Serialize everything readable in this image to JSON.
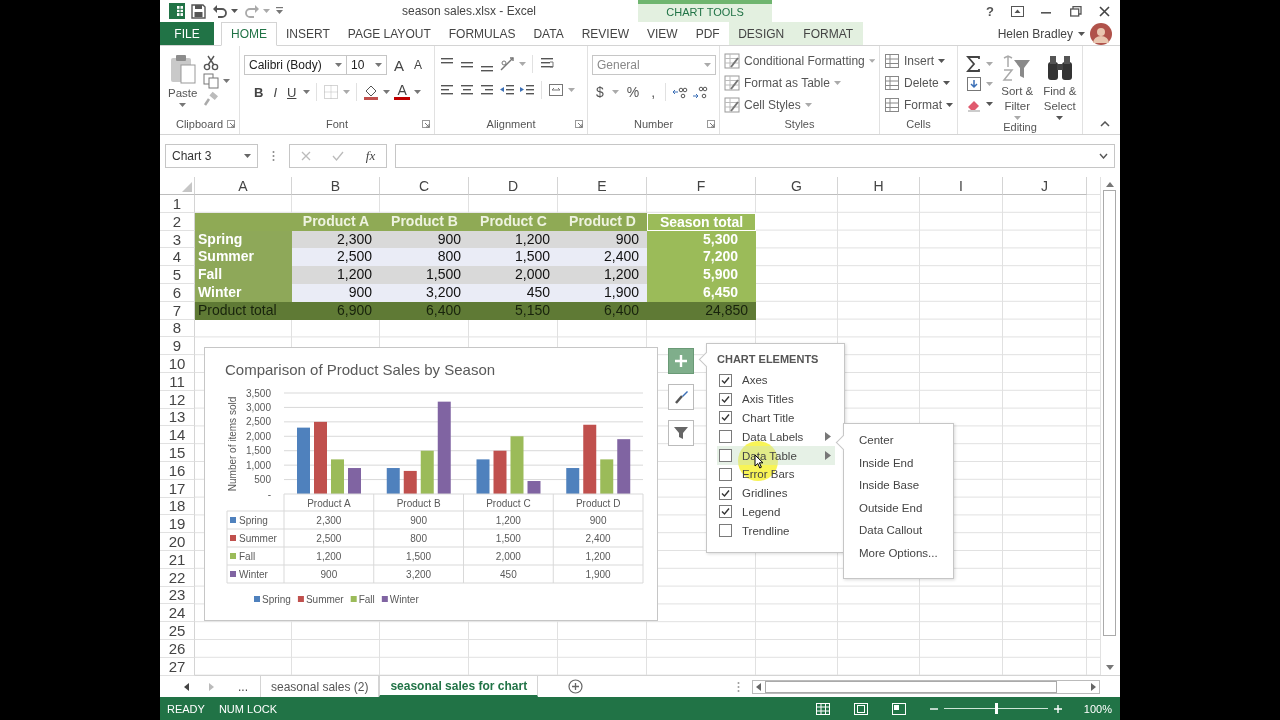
{
  "window": {
    "title": "season sales.xlsx - Excel",
    "contextual_group": "CHART TOOLS",
    "help": "?"
  },
  "account": {
    "user": "Helen Bradley"
  },
  "ribbon_tabs": [
    {
      "label": "FILE",
      "kind": "file",
      "selected": false
    },
    {
      "label": "HOME",
      "kind": "normal",
      "selected": true
    },
    {
      "label": "INSERT",
      "kind": "normal",
      "selected": false
    },
    {
      "label": "PAGE LAYOUT",
      "kind": "normal",
      "selected": false
    },
    {
      "label": "FORMULAS",
      "kind": "normal",
      "selected": false
    },
    {
      "label": "DATA",
      "kind": "normal",
      "selected": false
    },
    {
      "label": "REVIEW",
      "kind": "normal",
      "selected": false
    },
    {
      "label": "VIEW",
      "kind": "normal",
      "selected": false
    },
    {
      "label": "PDF",
      "kind": "normal",
      "selected": false
    },
    {
      "label": "DESIGN",
      "kind": "contextual",
      "selected": false
    },
    {
      "label": "FORMAT",
      "kind": "contextual",
      "selected": false
    }
  ],
  "ribbon": {
    "clipboard": {
      "paste": "Paste",
      "label": "Clipboard"
    },
    "font": {
      "font_name": "Calibri (Body)",
      "font_size": "10",
      "grow": "A",
      "shrink": "A",
      "styles": [
        "B",
        "I",
        "U"
      ],
      "font_color": "A",
      "label": "Font"
    },
    "alignment": {
      "label": "Alignment"
    },
    "number": {
      "format": "General",
      "symbols": [
        "$",
        "%",
        ","
      ],
      "label": "Number"
    },
    "styles": {
      "items": [
        "Conditional Formatting",
        "Format as Table",
        "Cell Styles"
      ],
      "label": "Styles"
    },
    "cells": {
      "items": [
        "Insert",
        "Delete",
        "Format"
      ],
      "label": "Cells"
    },
    "editing": {
      "sort": "Sort & Filter",
      "find": "Find & Select",
      "label": "Editing"
    }
  },
  "formula_bar": {
    "name_box": "Chart 3",
    "function_label": "fx"
  },
  "sheet": {
    "columns": [
      "A",
      "B",
      "C",
      "D",
      "E",
      "F",
      "G",
      "H",
      "I",
      "J"
    ],
    "rows": [
      {
        "number": "1",
        "kind": "blank"
      },
      {
        "number": "2",
        "kind": "header",
        "cells": [
          null,
          "Product A",
          "Product B",
          "Product C",
          "Product D",
          "Season total"
        ]
      },
      {
        "number": "3",
        "kind": "data",
        "cells": [
          "Spring",
          "2,300",
          "900",
          "1,200",
          "900",
          "5,300"
        ]
      },
      {
        "number": "4",
        "kind": "data",
        "cells": [
          "Summer",
          "2,500",
          "800",
          "1,500",
          "2,400",
          "7,200"
        ]
      },
      {
        "number": "5",
        "kind": "data",
        "cells": [
          "Fall",
          "1,200",
          "1,500",
          "2,000",
          "1,200",
          "5,900"
        ]
      },
      {
        "number": "6",
        "kind": "data",
        "cells": [
          "Winter",
          "900",
          "3,200",
          "450",
          "1,900",
          "6,450"
        ]
      },
      {
        "number": "7",
        "kind": "total",
        "cells": [
          "Product total",
          "6,900",
          "6,400",
          "5,150",
          "6,400",
          "24,850"
        ]
      },
      {
        "number": "8",
        "kind": "blank"
      },
      {
        "number": "9",
        "kind": "blank"
      },
      {
        "number": "10",
        "kind": "blank"
      },
      {
        "number": "11",
        "kind": "blank"
      },
      {
        "number": "12",
        "kind": "blank"
      },
      {
        "number": "13",
        "kind": "blank"
      },
      {
        "number": "14",
        "kind": "blank"
      },
      {
        "number": "15",
        "kind": "blank"
      },
      {
        "number": "16",
        "kind": "blank"
      },
      {
        "number": "17",
        "kind": "blank"
      },
      {
        "number": "18",
        "kind": "blank"
      },
      {
        "number": "19",
        "kind": "blank"
      },
      {
        "number": "20",
        "kind": "blank"
      },
      {
        "number": "21",
        "kind": "blank"
      },
      {
        "number": "22",
        "kind": "blank"
      },
      {
        "number": "23",
        "kind": "blank"
      },
      {
        "number": "24",
        "kind": "blank"
      },
      {
        "number": "25",
        "kind": "blank"
      },
      {
        "number": "26",
        "kind": "blank"
      },
      {
        "number": "27",
        "kind": "blank"
      }
    ]
  },
  "chart": {
    "chart_data": {
      "type": "bar",
      "title": "Comparison of Product Sales by Season",
      "ylabel": "Number of items sold",
      "categories": [
        "Product A",
        "Product B",
        "Product C",
        "Product D"
      ],
      "series": [
        {
          "name": "Spring",
          "color": "#4f81bd",
          "values": [
            2300,
            900,
            1200,
            900
          ]
        },
        {
          "name": "Summer",
          "color": "#c0504d",
          "values": [
            2500,
            800,
            1500,
            2400
          ]
        },
        {
          "name": "Fall",
          "color": "#9bbb59",
          "values": [
            1200,
            1500,
            2000,
            1200
          ]
        },
        {
          "name": "Winter",
          "color": "#8064a2",
          "values": [
            900,
            3200,
            450,
            1900
          ]
        }
      ],
      "ylim": [
        0,
        3500
      ],
      "grid": true,
      "legend": true,
      "yticks": [
        {
          "value": 0,
          "label": "-"
        },
        {
          "value": 500,
          "label": "500"
        },
        {
          "value": 1000,
          "label": "1,000"
        },
        {
          "value": 1500,
          "label": "1,500"
        },
        {
          "value": 2000,
          "label": "2,000"
        },
        {
          "value": 2500,
          "label": "2,500"
        },
        {
          "value": 3000,
          "label": "3,000"
        },
        {
          "value": 3500,
          "label": "3,500"
        }
      ]
    },
    "data_table": [
      {
        "label": "Spring",
        "cells": [
          "2,300",
          "900",
          "1,200",
          "900"
        ]
      },
      {
        "label": "Summer",
        "cells": [
          "2,500",
          "800",
          "1,500",
          "2,400"
        ]
      },
      {
        "label": "Fall",
        "cells": [
          "1,200",
          "1,500",
          "2,000",
          "1,200"
        ]
      },
      {
        "label": "Winter",
        "cells": [
          "900",
          "3,200",
          "450",
          "1,900"
        ]
      }
    ],
    "buttons": [
      {
        "kind": "elements",
        "selected": true
      },
      {
        "kind": "styles",
        "selected": false
      },
      {
        "kind": "filters",
        "selected": false
      }
    ]
  },
  "chart_elements": {
    "title": "CHART ELEMENTS",
    "items": [
      {
        "label": "Axes",
        "checked": true,
        "submenu": false,
        "hovered": false
      },
      {
        "label": "Axis Titles",
        "checked": true,
        "submenu": false,
        "hovered": false
      },
      {
        "label": "Chart Title",
        "checked": true,
        "submenu": false,
        "hovered": false
      },
      {
        "label": "Data Labels",
        "checked": false,
        "submenu": true,
        "hovered": false
      },
      {
        "label": "Data Table",
        "checked": false,
        "submenu": true,
        "hovered": true
      },
      {
        "label": "Error Bars",
        "checked": false,
        "submenu": false,
        "hovered": false
      },
      {
        "label": "Gridlines",
        "checked": true,
        "submenu": false,
        "hovered": false
      },
      {
        "label": "Legend",
        "checked": true,
        "submenu": false,
        "hovered": false
      },
      {
        "label": "Trendline",
        "checked": false,
        "submenu": false,
        "hovered": false
      }
    ],
    "submenu": [
      "Center",
      "Inside End",
      "Inside Base",
      "Outside End",
      "Data Callout",
      "More Options..."
    ]
  },
  "sheet_tabs": {
    "overflow": "...",
    "tabs": [
      {
        "label": "seasonal sales (2)",
        "selected": false
      },
      {
        "label": "seasonal sales for chart",
        "selected": true
      }
    ]
  },
  "status_bar": {
    "items": [
      "READY",
      "NUM LOCK"
    ],
    "zoom": {
      "level": 0.5,
      "reading": "100%"
    }
  }
}
